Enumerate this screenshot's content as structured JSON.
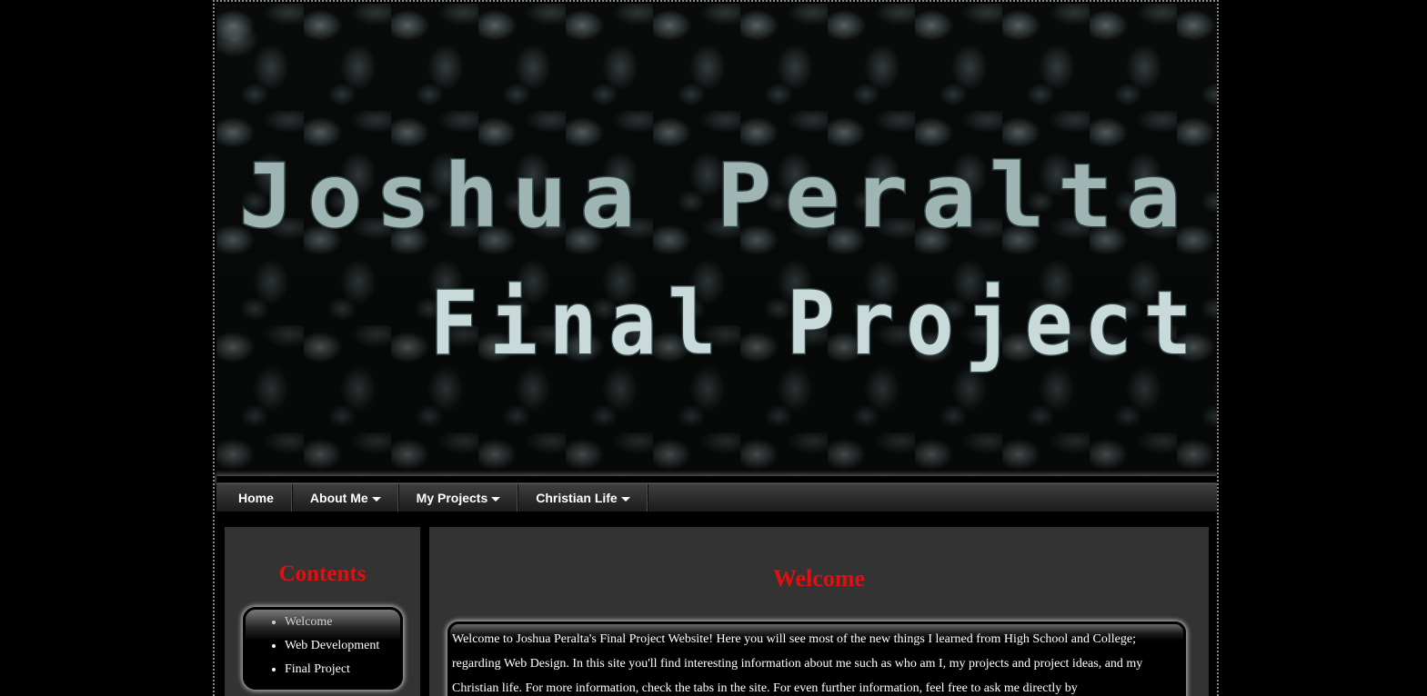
{
  "banner": {
    "title_line1": "Joshua Peralta",
    "title_line2": "Final Project"
  },
  "nav": {
    "items": [
      {
        "label": "Home",
        "dropdown": false
      },
      {
        "label": "About Me",
        "dropdown": true
      },
      {
        "label": "My Projects",
        "dropdown": true
      },
      {
        "label": "Christian Life",
        "dropdown": true
      }
    ]
  },
  "sidebar": {
    "title": "Contents",
    "items": [
      {
        "label": "Welcome"
      },
      {
        "label": "Web Development"
      },
      {
        "label": "Final Project"
      }
    ]
  },
  "main": {
    "title": "Welcome",
    "body": "Welcome to Joshua Peralta's Final Project Website! Here you will see most of the new things I learned from High School and College; regarding Web Design. In this site you'll find interesting information about me such as who am I, my projects and project ideas, and my Christian life. For more information, check the tabs in the site. For even further information, feel free to ask me directly by"
  },
  "colors": {
    "heading_red": "#e01010",
    "panel_gray": "#333333",
    "background": "#000000"
  }
}
